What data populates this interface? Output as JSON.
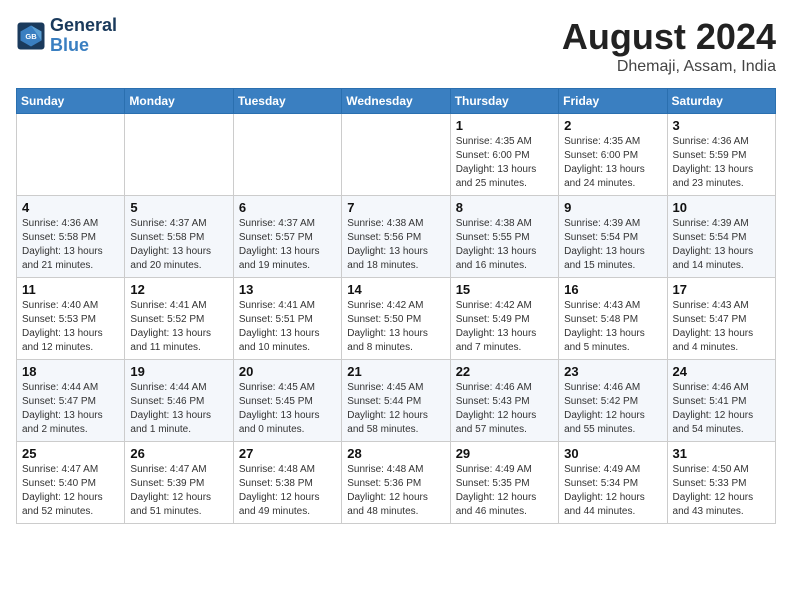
{
  "logo": {
    "line1": "General",
    "line2": "Blue"
  },
  "title": "August 2024",
  "location": "Dhemaji, Assam, India",
  "weekdays": [
    "Sunday",
    "Monday",
    "Tuesday",
    "Wednesday",
    "Thursday",
    "Friday",
    "Saturday"
  ],
  "weeks": [
    [
      {
        "day": "",
        "info": ""
      },
      {
        "day": "",
        "info": ""
      },
      {
        "day": "",
        "info": ""
      },
      {
        "day": "",
        "info": ""
      },
      {
        "day": "1",
        "info": "Sunrise: 4:35 AM\nSunset: 6:00 PM\nDaylight: 13 hours\nand 25 minutes."
      },
      {
        "day": "2",
        "info": "Sunrise: 4:35 AM\nSunset: 6:00 PM\nDaylight: 13 hours\nand 24 minutes."
      },
      {
        "day": "3",
        "info": "Sunrise: 4:36 AM\nSunset: 5:59 PM\nDaylight: 13 hours\nand 23 minutes."
      }
    ],
    [
      {
        "day": "4",
        "info": "Sunrise: 4:36 AM\nSunset: 5:58 PM\nDaylight: 13 hours\nand 21 minutes."
      },
      {
        "day": "5",
        "info": "Sunrise: 4:37 AM\nSunset: 5:58 PM\nDaylight: 13 hours\nand 20 minutes."
      },
      {
        "day": "6",
        "info": "Sunrise: 4:37 AM\nSunset: 5:57 PM\nDaylight: 13 hours\nand 19 minutes."
      },
      {
        "day": "7",
        "info": "Sunrise: 4:38 AM\nSunset: 5:56 PM\nDaylight: 13 hours\nand 18 minutes."
      },
      {
        "day": "8",
        "info": "Sunrise: 4:38 AM\nSunset: 5:55 PM\nDaylight: 13 hours\nand 16 minutes."
      },
      {
        "day": "9",
        "info": "Sunrise: 4:39 AM\nSunset: 5:54 PM\nDaylight: 13 hours\nand 15 minutes."
      },
      {
        "day": "10",
        "info": "Sunrise: 4:39 AM\nSunset: 5:54 PM\nDaylight: 13 hours\nand 14 minutes."
      }
    ],
    [
      {
        "day": "11",
        "info": "Sunrise: 4:40 AM\nSunset: 5:53 PM\nDaylight: 13 hours\nand 12 minutes."
      },
      {
        "day": "12",
        "info": "Sunrise: 4:41 AM\nSunset: 5:52 PM\nDaylight: 13 hours\nand 11 minutes."
      },
      {
        "day": "13",
        "info": "Sunrise: 4:41 AM\nSunset: 5:51 PM\nDaylight: 13 hours\nand 10 minutes."
      },
      {
        "day": "14",
        "info": "Sunrise: 4:42 AM\nSunset: 5:50 PM\nDaylight: 13 hours\nand 8 minutes."
      },
      {
        "day": "15",
        "info": "Sunrise: 4:42 AM\nSunset: 5:49 PM\nDaylight: 13 hours\nand 7 minutes."
      },
      {
        "day": "16",
        "info": "Sunrise: 4:43 AM\nSunset: 5:48 PM\nDaylight: 13 hours\nand 5 minutes."
      },
      {
        "day": "17",
        "info": "Sunrise: 4:43 AM\nSunset: 5:47 PM\nDaylight: 13 hours\nand 4 minutes."
      }
    ],
    [
      {
        "day": "18",
        "info": "Sunrise: 4:44 AM\nSunset: 5:47 PM\nDaylight: 13 hours\nand 2 minutes."
      },
      {
        "day": "19",
        "info": "Sunrise: 4:44 AM\nSunset: 5:46 PM\nDaylight: 13 hours\nand 1 minute."
      },
      {
        "day": "20",
        "info": "Sunrise: 4:45 AM\nSunset: 5:45 PM\nDaylight: 13 hours\nand 0 minutes."
      },
      {
        "day": "21",
        "info": "Sunrise: 4:45 AM\nSunset: 5:44 PM\nDaylight: 12 hours\nand 58 minutes."
      },
      {
        "day": "22",
        "info": "Sunrise: 4:46 AM\nSunset: 5:43 PM\nDaylight: 12 hours\nand 57 minutes."
      },
      {
        "day": "23",
        "info": "Sunrise: 4:46 AM\nSunset: 5:42 PM\nDaylight: 12 hours\nand 55 minutes."
      },
      {
        "day": "24",
        "info": "Sunrise: 4:46 AM\nSunset: 5:41 PM\nDaylight: 12 hours\nand 54 minutes."
      }
    ],
    [
      {
        "day": "25",
        "info": "Sunrise: 4:47 AM\nSunset: 5:40 PM\nDaylight: 12 hours\nand 52 minutes."
      },
      {
        "day": "26",
        "info": "Sunrise: 4:47 AM\nSunset: 5:39 PM\nDaylight: 12 hours\nand 51 minutes."
      },
      {
        "day": "27",
        "info": "Sunrise: 4:48 AM\nSunset: 5:38 PM\nDaylight: 12 hours\nand 49 minutes."
      },
      {
        "day": "28",
        "info": "Sunrise: 4:48 AM\nSunset: 5:36 PM\nDaylight: 12 hours\nand 48 minutes."
      },
      {
        "day": "29",
        "info": "Sunrise: 4:49 AM\nSunset: 5:35 PM\nDaylight: 12 hours\nand 46 minutes."
      },
      {
        "day": "30",
        "info": "Sunrise: 4:49 AM\nSunset: 5:34 PM\nDaylight: 12 hours\nand 44 minutes."
      },
      {
        "day": "31",
        "info": "Sunrise: 4:50 AM\nSunset: 5:33 PM\nDaylight: 12 hours\nand 43 minutes."
      }
    ]
  ]
}
